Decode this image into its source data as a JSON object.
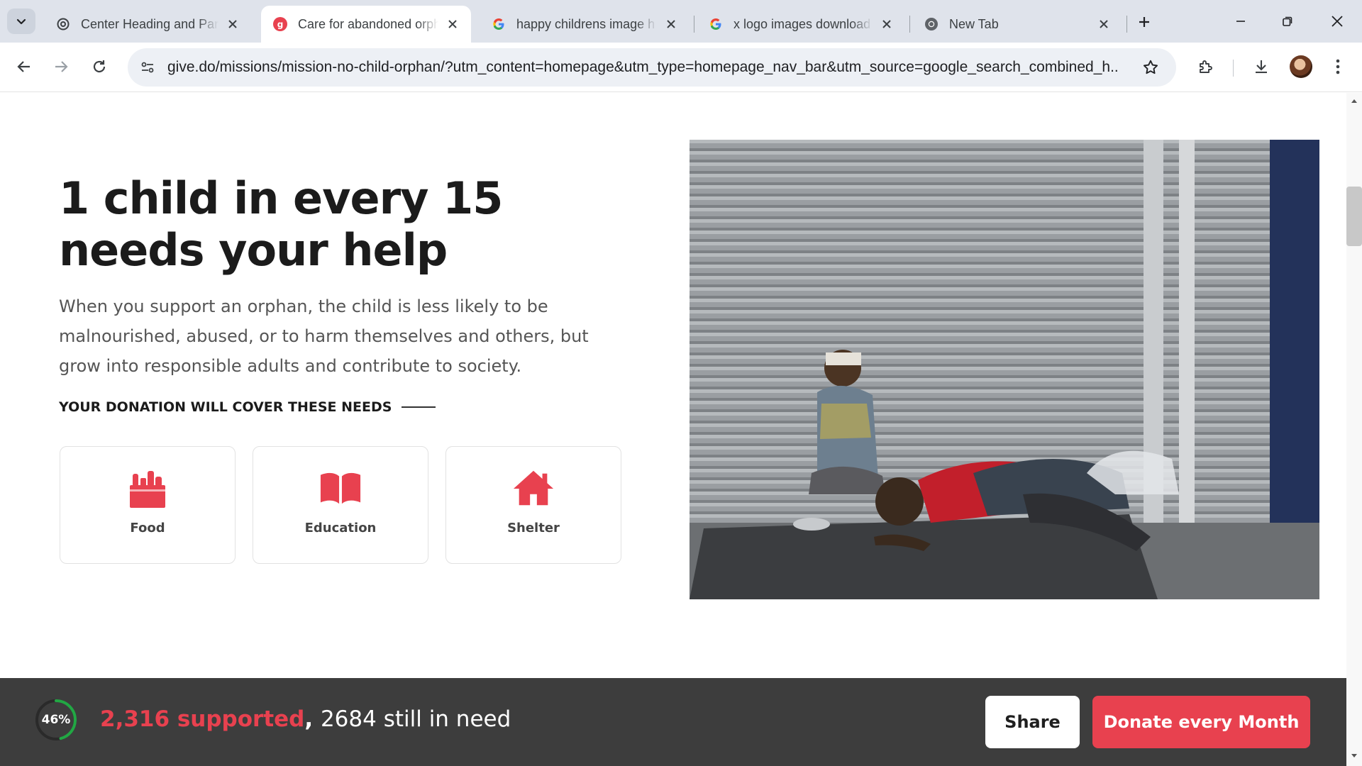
{
  "browser": {
    "tabs": [
      {
        "title": "Center Heading and Para",
        "favicon": "openai-icon",
        "active": false
      },
      {
        "title": "Care for abandoned orph",
        "favicon": "givedo-icon",
        "active": true
      },
      {
        "title": "happy childrens image h",
        "favicon": "google-icon",
        "active": false
      },
      {
        "title": "x logo images download",
        "favicon": "google-icon",
        "active": false
      },
      {
        "title": "New Tab",
        "favicon": "chrome-icon",
        "active": false
      }
    ],
    "url": "give.do/missions/mission-no-child-orphan/?utm_content=homepage&utm_type=homepage_nav_bar&utm_source=google_search_combined_h..."
  },
  "main": {
    "headline": "1 child in every 15 needs your help",
    "description": "When you support an orphan, the child is less likely to be malnourished, abused, or to harm themselves and others, but grow into responsible adults and contribute to society.",
    "needs_heading": "YOUR DONATION WILL COVER THESE NEEDS",
    "needs": [
      {
        "label": "Food",
        "icon": "grocery-bag-icon"
      },
      {
        "label": "Education",
        "icon": "open-book-icon"
      },
      {
        "label": "Shelter",
        "icon": "house-icon"
      }
    ]
  },
  "footer": {
    "progress_label": "46%",
    "progress_value": 0.46,
    "supported": "2,316 supported",
    "separator": ",",
    "still_in_need": "2684 still in need",
    "share_label": "Share",
    "donate_label": "Donate every Month"
  },
  "colors": {
    "accent": "#e8414f",
    "footer_bg": "#3d3d3d",
    "progress_ring": "#22a744"
  }
}
